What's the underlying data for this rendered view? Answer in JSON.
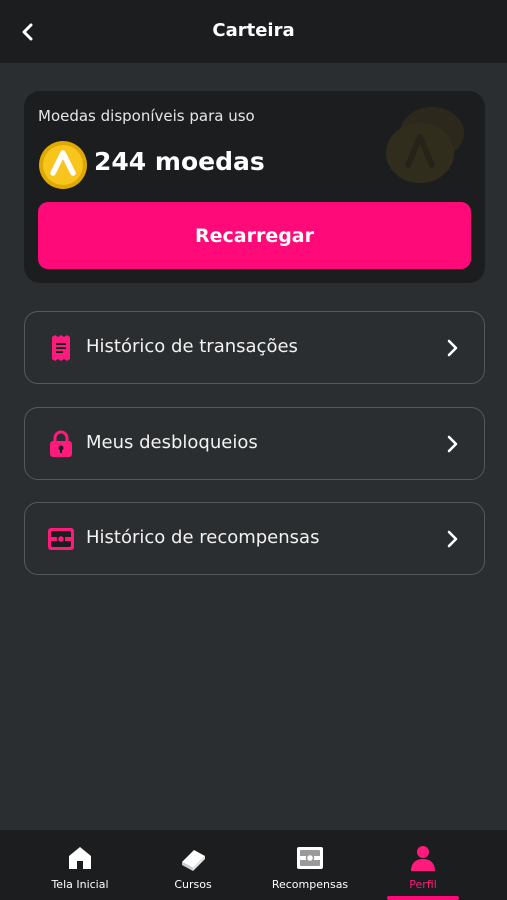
{
  "header": {
    "title": "Carteira",
    "back_icon": "chevron-left-icon"
  },
  "wallet": {
    "label": "Moedas disponíveis para uso",
    "amount": "244 moedas",
    "coin_icon": "coin-icon",
    "recharge_label": "Recarregar"
  },
  "menu": [
    {
      "label": "Histórico de transações",
      "icon": "receipt-icon"
    },
    {
      "label": "Meus desbloqueios",
      "icon": "lock-icon"
    },
    {
      "label": "Histórico de recompensas",
      "icon": "reward-chest-icon"
    }
  ],
  "bottom_nav": {
    "items": [
      {
        "label": "Tela Inicial",
        "icon": "home-icon"
      },
      {
        "label": "Cursos",
        "icon": "book-icon"
      },
      {
        "label": "Recompensas",
        "icon": "chest-icon"
      },
      {
        "label": "Perfil",
        "icon": "profile-icon"
      }
    ],
    "active_index": 3
  },
  "colors": {
    "accent": "#ff0a78",
    "background": "#2b2e30",
    "surface": "#1c1d1f",
    "coin": "#f5c518"
  }
}
